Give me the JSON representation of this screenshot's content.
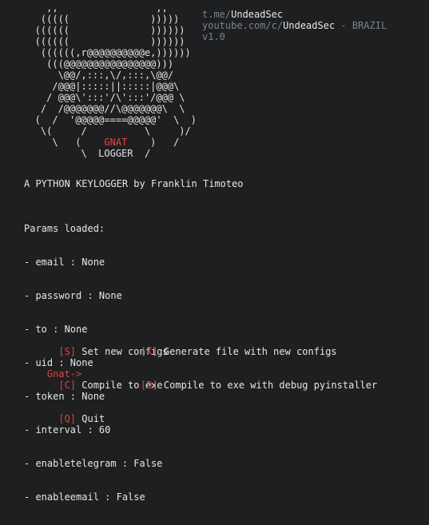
{
  "window": {
    "type": "terminal"
  },
  "colors": {
    "background": "#1d1f21",
    "text": "#e6e6e6",
    "accent_red": "#e0443e",
    "dim": "#7d8187"
  },
  "banner": {
    "ascii_lines": [
      "     ,,                 ,,",
      "    (((((              )))))",
      "   ((((((              ))))))",
      "   ((((((              ))))))",
      "    ((((((,r@@@@@@@@@@e,))))))",
      "     (((@@@@@@@@@@@@@@@@)))",
      "       \\@@/,:::,\\/,:::,\\@@/",
      "      /@@@|:::::||:::::|@@@\\",
      "     / @@@\\':::'/\\':::'/@@@ \\",
      "    /  /@@@@@@@//\\@@@@@@@\\  \\",
      "   (  /  '@@@@@====@@@@@'  \\  )",
      "    \\(     /          \\     )/",
      "      \\   (           )   /",
      "           \\  LOGGER  /"
    ],
    "gnat_prefix": "      \\   (    ",
    "gnat_word": "GNAT",
    "gnat_suffix": "    )   /"
  },
  "social": {
    "telegram_prefix": "t.me/",
    "telegram_handle": "UndeadSec",
    "youtube_prefix": "youtube.com/c/",
    "youtube_handle": "UndeadSec",
    "youtube_suffix": " - BRAZIL",
    "version": "v1.0"
  },
  "title": "A PYTHON KEYLOGGER by Franklin Timoteo",
  "params": {
    "header": "Params loaded:",
    "items": [
      "- email : None",
      "- password : None",
      "- to : None",
      "- uid : None",
      "- token : None",
      "- interval : 60",
      "- enabletelegram : False",
      "- enableemail : False"
    ]
  },
  "menu": {
    "set_key": "[S]",
    "set_label": " Set new configs",
    "generate_key": "[K]",
    "generate_label": " Generate file with new configs",
    "compile_key": "[C]",
    "compile_label": " Compile to exe",
    "compile_debug_key": "[D]",
    "compile_debug_label": " Compile to exe with debug pyinstaller",
    "quit_key": "[Q]",
    "quit_label": " Quit"
  },
  "prompt": {
    "label": "Gnat->"
  }
}
